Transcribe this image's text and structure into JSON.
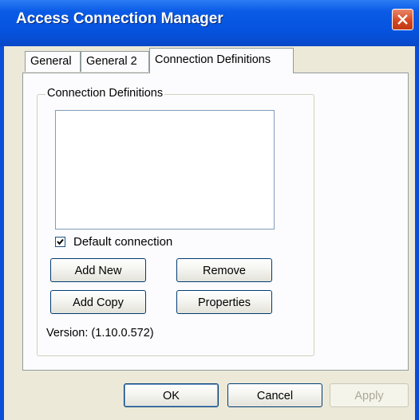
{
  "window": {
    "title": "Access Connection Manager"
  },
  "tabs": [
    {
      "label": "General",
      "active": false
    },
    {
      "label": "General 2",
      "active": false
    },
    {
      "label": "Connection Definitions",
      "active": true
    }
  ],
  "group": {
    "label": "Connection Definitions",
    "list_items": [],
    "default_connection": {
      "label": "Default connection",
      "checked": true
    },
    "buttons": {
      "add_new": "Add New",
      "remove": "Remove",
      "add_copy": "Add Copy",
      "properties": "Properties"
    },
    "version": "Version: (1.10.0.572)"
  },
  "footer": {
    "ok": "OK",
    "cancel": "Cancel",
    "apply": "Apply",
    "apply_enabled": false
  },
  "icons": {
    "close": "close-icon",
    "check": "checkmark-icon"
  },
  "colors": {
    "titlebar": "#0a5be6",
    "dialog_bg": "#ece9d8",
    "panel_bg": "#fcfcfe",
    "close_red": "#d2451f"
  }
}
